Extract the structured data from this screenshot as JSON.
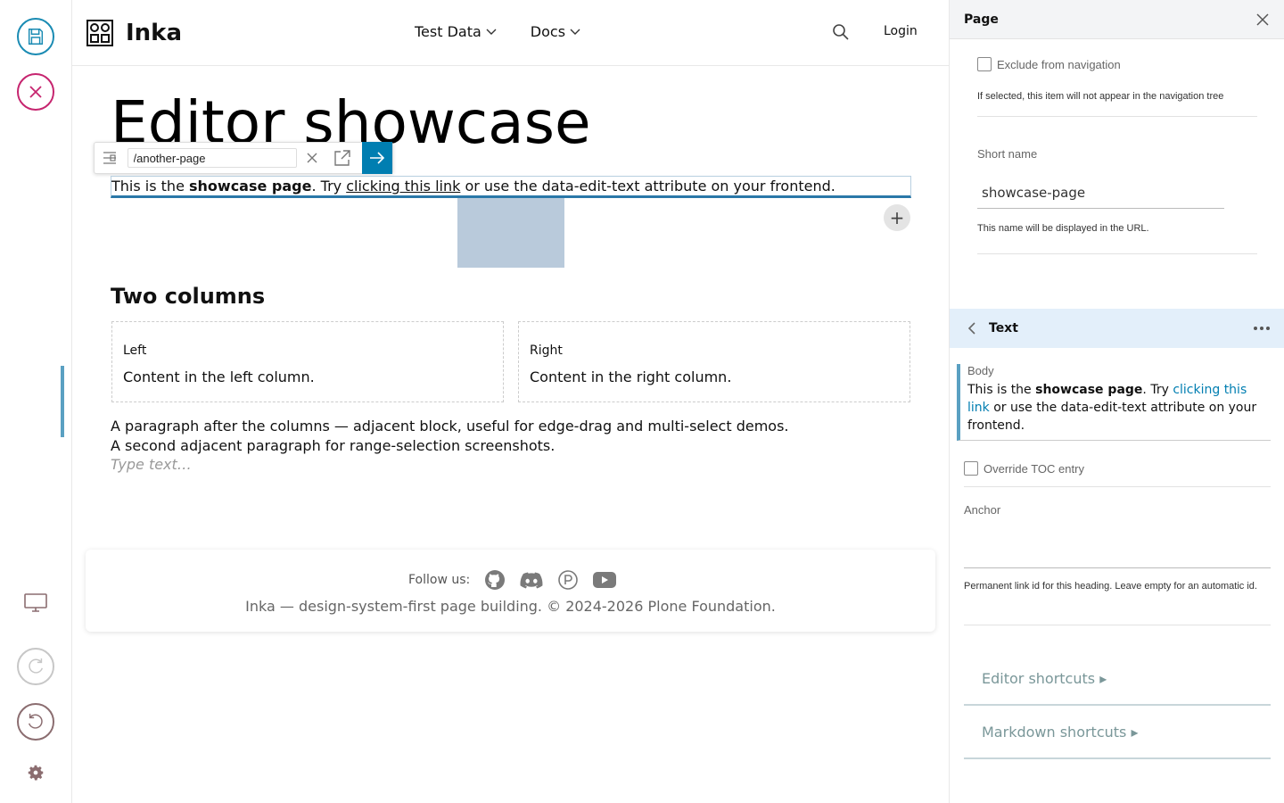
{
  "app": {
    "brand": "Inka",
    "nav": [
      {
        "label": "Test Data"
      },
      {
        "label": "Docs"
      }
    ],
    "login": "Login"
  },
  "toolbar": {
    "save": "save-icon",
    "cancel": "close-icon",
    "display": "monitor-icon",
    "redo": "redo-icon",
    "undo": "undo-icon",
    "settings": "gear-icon",
    "colors": {
      "save": "#1a8bb3",
      "cancel": "#c6256f",
      "undo": "#8b6d70",
      "settings": "#8b6d70"
    }
  },
  "page": {
    "title": "Editor showcase",
    "link_input": "/another-page",
    "para": {
      "pre": "This is the ",
      "bold": "showcase page",
      "mid": ". Try ",
      "link": "clicking this link",
      "post": " or use the data-edit-text attribute on your frontend."
    },
    "add_symbol": "+",
    "two_columns_title": "Two columns",
    "left_label": "Left",
    "left_text": "Content in the left column.",
    "right_label": "Right",
    "right_text": "Content in the right column.",
    "para_after_1": "A paragraph after the columns — adjacent block, useful for edge-drag and multi-select demos.",
    "para_after_2": "A second adjacent paragraph for range-selection screenshots.",
    "type_placeholder": "Type text…"
  },
  "footer": {
    "follow": "Follow us:",
    "copyright": "Inka — design-system-first page building. © 2024-2026 Plone Foundation."
  },
  "sidebar": {
    "title": "Page",
    "exclude_label": "Exclude from navigation",
    "exclude_help": "If selected, this item will not appear in the navigation tree",
    "short_name_label": "Short name",
    "short_name_value": "showcase-page",
    "short_name_help": "This name will be displayed in the URL.",
    "text_section": "Text",
    "body_label": "Body",
    "override_toc": "Override TOC entry",
    "anchor_label": "Anchor",
    "anchor_help": "Permanent link id for this heading. Leave empty for an automatic id.",
    "editor_shortcuts": "Editor shortcuts ▸",
    "markdown_shortcuts": "Markdown shortcuts ▸"
  }
}
